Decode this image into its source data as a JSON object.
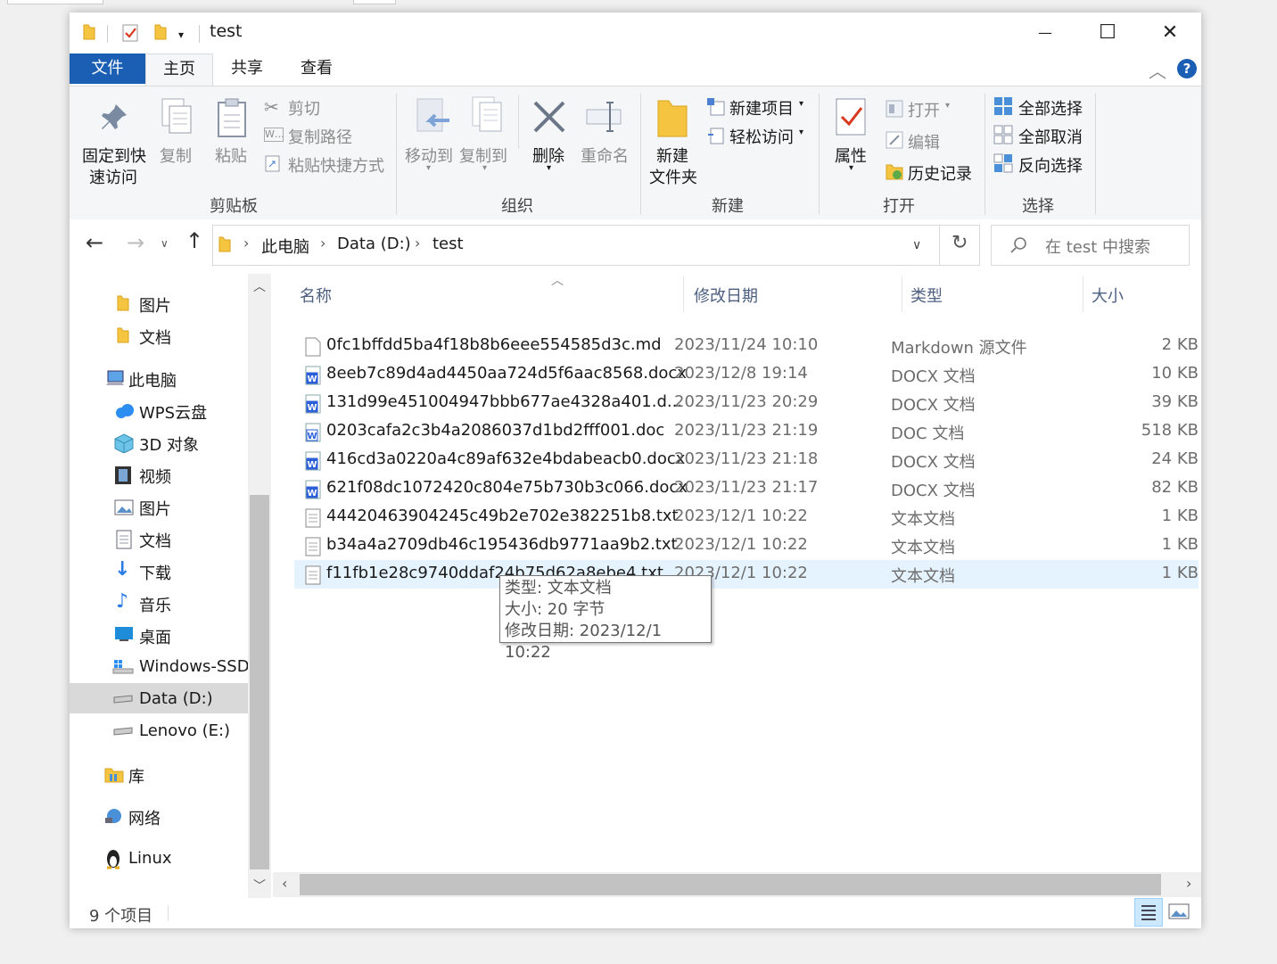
{
  "window": {
    "title": "test",
    "controls": {
      "minimize": "—",
      "maximize": "☐",
      "close": "✕"
    }
  },
  "ribbon_tabs": {
    "file": "文件",
    "home": "主页",
    "share": "共享",
    "view": "查看"
  },
  "clipboard": {
    "pin_line1": "固定到快",
    "pin_line2": "速访问",
    "copy": "复制",
    "paste": "粘贴",
    "cut": "剪切",
    "copy_path": "复制路径",
    "paste_shortcut": "粘贴快捷方式",
    "group": "剪贴板"
  },
  "organize": {
    "move_to": "移动到",
    "copy_to": "复制到",
    "delete": "删除",
    "rename": "重命名",
    "group": "组织"
  },
  "new": {
    "new_item": "新建项目",
    "easy_access": "轻松访问",
    "new_folder_line1": "新建",
    "new_folder_line2": "文件夹",
    "group": "新建"
  },
  "open": {
    "properties": "属性",
    "open": "打开",
    "edit": "编辑",
    "history": "历史记录",
    "group": "打开"
  },
  "select": {
    "select_all": "全部选择",
    "select_none": "全部取消",
    "invert": "反向选择",
    "group": "选择"
  },
  "address": {
    "crumbs": [
      "此电脑",
      "Data (D:)",
      "test"
    ],
    "search_placeholder": "在 test 中搜索"
  },
  "nav": {
    "quick": [
      "图片",
      "文档"
    ],
    "this_pc": "此电脑",
    "pc_items": [
      "WPS云盘",
      "3D 对象",
      "视频",
      "图片",
      "文档",
      "下载",
      "音乐",
      "桌面",
      "Windows-SSD",
      "Data (D:)",
      "Lenovo (E:)"
    ],
    "library": "库",
    "network": "网络",
    "linux": "Linux"
  },
  "columns": {
    "name": "名称",
    "date": "修改日期",
    "type": "类型",
    "size": "大小"
  },
  "files": [
    {
      "name": "0fc1bffdd5ba4f18b8b6eee554585d3c.md",
      "date": "2023/11/24 10:10",
      "type": "Markdown 源文件",
      "size": "2 KB",
      "icon": "md"
    },
    {
      "name": "8eeb7c89d4ad4450aa724d5f6aac8568.docx",
      "date": "2023/12/8 19:14",
      "type": "DOCX 文档",
      "size": "10 KB",
      "icon": "docx"
    },
    {
      "name": "131d99e451004947bbb677ae4328a401.d...",
      "date": "2023/11/23 20:29",
      "type": "DOCX 文档",
      "size": "39 KB",
      "icon": "docx"
    },
    {
      "name": "0203cafa2c3b4a2086037d1bd2fff001.doc",
      "date": "2023/11/23 21:19",
      "type": "DOC 文档",
      "size": "518 KB",
      "icon": "doc"
    },
    {
      "name": "416cd3a0220a4c89af632e4bdabeacb0.docx",
      "date": "2023/11/23 21:18",
      "type": "DOCX 文档",
      "size": "24 KB",
      "icon": "docx"
    },
    {
      "name": "621f08dc1072420c804e75b730b3c066.docx",
      "date": "2023/11/23 21:17",
      "type": "DOCX 文档",
      "size": "82 KB",
      "icon": "docx"
    },
    {
      "name": "44420463904245c49b2e702e382251b8.txt",
      "date": "2023/12/1 10:22",
      "type": "文本文档",
      "size": "1 KB",
      "icon": "txt"
    },
    {
      "name": "b34a4a2709db46c195436db9771aa9b2.txt",
      "date": "2023/12/1 10:22",
      "type": "文本文档",
      "size": "1 KB",
      "icon": "txt"
    },
    {
      "name": "f11fb1e28c9740ddaf24b75d62a8ebe4.txt",
      "date": "2023/12/1 10:22",
      "type": "文本文档",
      "size": "1 KB",
      "icon": "txt"
    }
  ],
  "tooltip": {
    "type_line": "类型: 文本文档",
    "size_line": "大小: 20 字节",
    "date_line": "修改日期: 2023/12/1 10:22"
  },
  "status": {
    "count": "9 个项目"
  },
  "colors": {
    "accent": "#1a5fb4",
    "selection": "#e5f3ff",
    "header_text": "#4d6082"
  }
}
